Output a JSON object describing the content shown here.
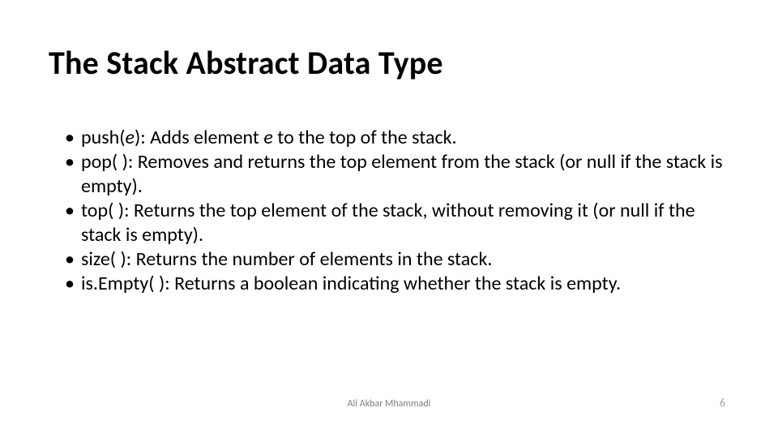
{
  "title": "The Stack Abstract Data Type",
  "items": [
    {
      "method_pre": "push(",
      "method_arg": "e",
      "method_post": ")",
      "desc_pre": ": Adds element ",
      "desc_em": "e",
      "desc_post": " to the top of the stack."
    },
    {
      "method": "pop( )",
      "desc": ": Removes and returns the top element from the stack (or null if the stack is empty)."
    },
    {
      "method": "top( )",
      "desc": ": Returns the top element of the stack, without removing it (or null if the stack is empty)."
    },
    {
      "method": "size( )",
      "desc": ": Returns the number of elements in the stack."
    },
    {
      "method": "is.Empty( )",
      "desc": ": Returns a boolean indicating whether the stack is empty."
    }
  ],
  "footer": {
    "author": "Ali Akbar Mhammadi",
    "page": "6"
  }
}
